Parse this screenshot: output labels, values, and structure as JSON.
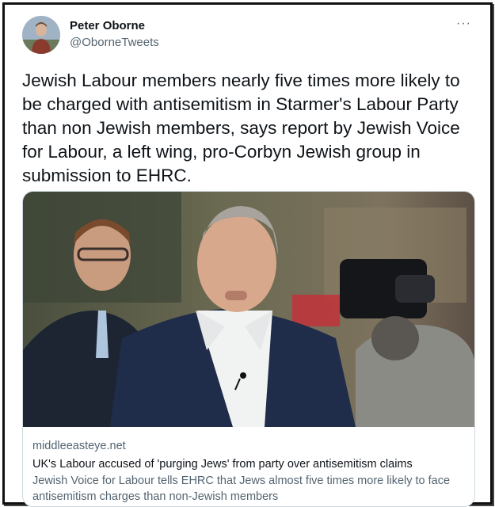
{
  "tweet": {
    "author_name": "Peter Oborne",
    "author_handle": "@OborneTweets",
    "text": "Jewish Labour members nearly five times more likely to be charged with antisemitism in Starmer's Labour Party than non Jewish members, says report by Jewish Voice for Labour, a left wing, pro-Corbyn Jewish group in submission to EHRC.",
    "more_icon": "···"
  },
  "card": {
    "domain": "middleeasteye.net",
    "title": "UK's Labour accused of 'purging Jews' from party over antisemitism claims",
    "description": "Jewish Voice for Labour tells EHRC that Jews almost five times more likely to face antisemitism charges than non-Jewish members"
  },
  "colors": {
    "primary_text": "#0f1419",
    "secondary_text": "#536471",
    "card_border": "#cfd9de"
  },
  "icons": {
    "more": "more-options-icon"
  }
}
